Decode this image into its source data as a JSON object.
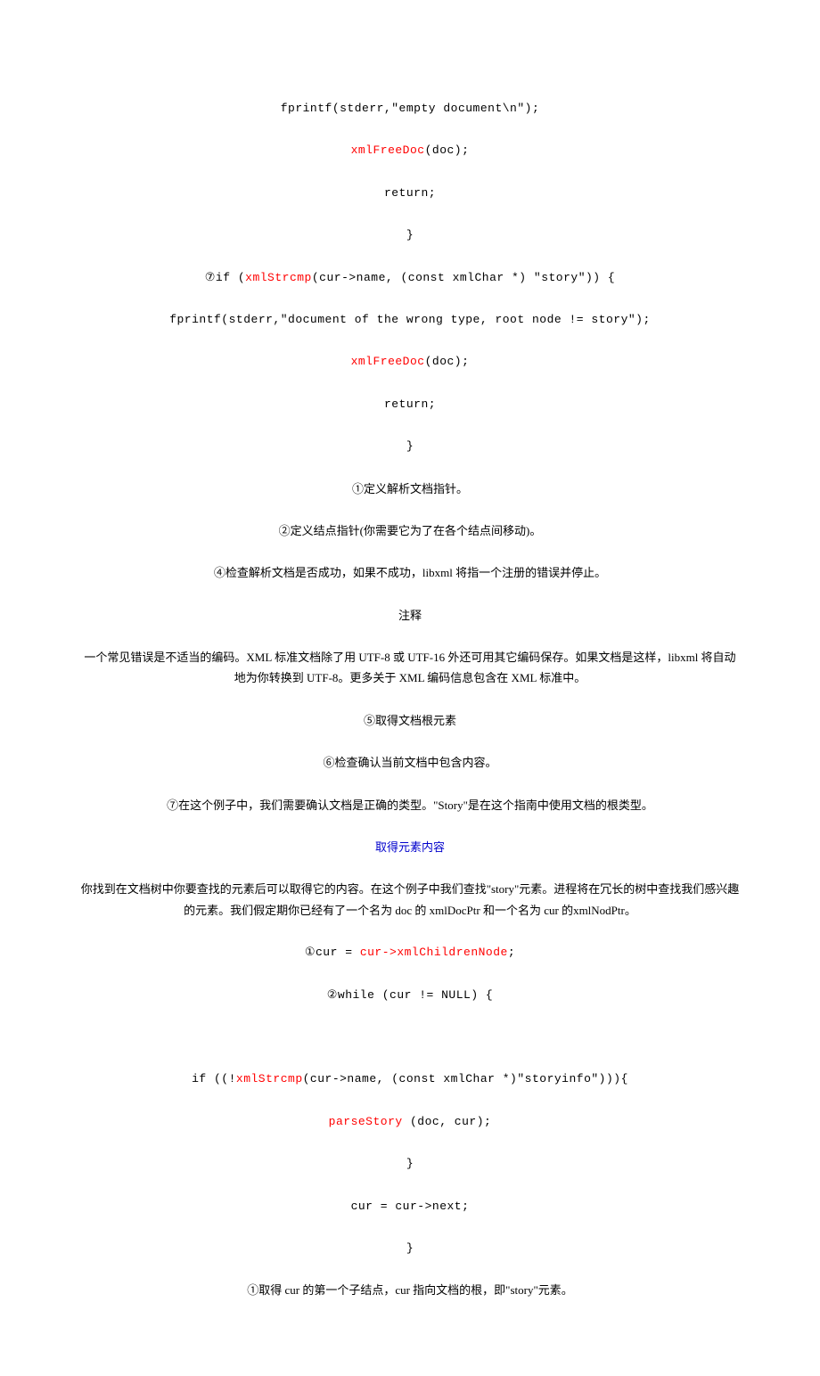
{
  "lines": [
    {
      "type": "codeparts",
      "parts": [
        {
          "text": "fprintf(stderr,\"empty document\\n\");",
          "cls": ""
        }
      ]
    },
    {
      "type": "codeparts",
      "parts": [
        {
          "text": "xmlFreeDoc",
          "cls": "red"
        },
        {
          "text": "(doc);",
          "cls": ""
        }
      ]
    },
    {
      "type": "codeparts",
      "parts": [
        {
          "text": "return;",
          "cls": ""
        }
      ]
    },
    {
      "type": "codeparts",
      "parts": [
        {
          "text": "}",
          "cls": ""
        }
      ]
    },
    {
      "type": "codeparts",
      "parts": [
        {
          "text": "⑦if (",
          "cls": ""
        },
        {
          "text": "xmlStrcmp",
          "cls": "red"
        },
        {
          "text": "(cur->name, (const xmlChar *) \"story\")) {",
          "cls": ""
        }
      ]
    },
    {
      "type": "codeparts",
      "parts": [
        {
          "text": "fprintf(stderr,\"document of the wrong type, root node != story\");",
          "cls": ""
        }
      ]
    },
    {
      "type": "codeparts",
      "parts": [
        {
          "text": "xmlFreeDoc",
          "cls": "red"
        },
        {
          "text": "(doc);",
          "cls": ""
        }
      ]
    },
    {
      "type": "codeparts",
      "parts": [
        {
          "text": "return;",
          "cls": ""
        }
      ]
    },
    {
      "type": "codeparts",
      "parts": [
        {
          "text": "}",
          "cls": ""
        }
      ]
    },
    {
      "type": "text",
      "text": "①定义解析文档指针。"
    },
    {
      "type": "text",
      "text": "②定义结点指针(你需要它为了在各个结点间移动)。"
    },
    {
      "type": "text",
      "text": "④检查解析文档是否成功，如果不成功，libxml 将指一个注册的错误并停止。"
    },
    {
      "type": "text",
      "text": "注释"
    },
    {
      "type": "text",
      "text": "一个常见错误是不适当的编码。XML 标准文档除了用 UTF-8 或 UTF-16 外还可用其它编码保存。如果文档是这样，libxml 将自动地为你转换到 UTF-8。更多关于 XML 编码信息包含在 XML 标准中。"
    },
    {
      "type": "text",
      "text": "⑤取得文档根元素"
    },
    {
      "type": "text",
      "text": "⑥检查确认当前文档中包含内容。"
    },
    {
      "type": "text",
      "text": "⑦在这个例子中，我们需要确认文档是正确的类型。\"Story\"是在这个指南中使用文档的根类型。"
    },
    {
      "type": "heading",
      "text": "取得元素内容"
    },
    {
      "type": "text",
      "text": "你找到在文档树中你要查找的元素后可以取得它的内容。在这个例子中我们查找\"story\"元素。进程将在冗长的树中查找我们感兴趣的元素。我们假定期你已经有了一个名为 doc 的 xmlDocPtr 和一个名为 cur 的xmlNodPtr。"
    },
    {
      "type": "codeparts",
      "parts": [
        {
          "text": "①cur = ",
          "cls": ""
        },
        {
          "text": "cur->xmlChildrenNode",
          "cls": "red"
        },
        {
          "text": ";",
          "cls": ""
        }
      ]
    },
    {
      "type": "codeparts",
      "parts": [
        {
          "text": "②while (cur != NULL) {",
          "cls": ""
        }
      ]
    },
    {
      "type": "blank"
    },
    {
      "type": "codeparts",
      "parts": [
        {
          "text": "if ((!",
          "cls": ""
        },
        {
          "text": "xmlStrcmp",
          "cls": "red"
        },
        {
          "text": "(cur->name, (const xmlChar *)\"storyinfo\"))){",
          "cls": ""
        }
      ]
    },
    {
      "type": "codeparts",
      "parts": [
        {
          "text": "parseStory",
          "cls": "red"
        },
        {
          "text": " (doc, cur);",
          "cls": ""
        }
      ]
    },
    {
      "type": "codeparts",
      "parts": [
        {
          "text": "}",
          "cls": ""
        }
      ]
    },
    {
      "type": "codeparts",
      "parts": [
        {
          "text": "cur = cur->next;",
          "cls": ""
        }
      ]
    },
    {
      "type": "codeparts",
      "parts": [
        {
          "text": "}",
          "cls": ""
        }
      ]
    },
    {
      "type": "text",
      "text": "①取得 cur 的第一个子结点，cur 指向文档的根，即\"story\"元素。"
    }
  ]
}
